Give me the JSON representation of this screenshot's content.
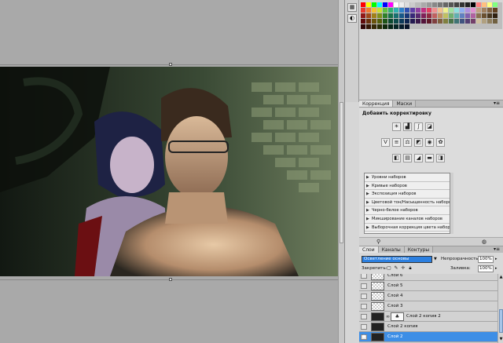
{
  "adjustments": {
    "tab_active": "Коррекция",
    "tab_inactive": "Маски",
    "title": "Добавить корректировку",
    "presets": [
      "Уровни наборов",
      "Кривые наборов",
      "Экспозиция наборов",
      "Цветовой тон/Насыщенность наборов",
      "Черно-белое наборов",
      "Микширование каналов наборов",
      "Выборочная коррекция цвета наборов"
    ]
  },
  "layers": {
    "tabs": [
      "Слои",
      "Каналы",
      "Контуры"
    ],
    "blend_mode": "Осветление основы",
    "opacity_label": "Непрозрачность:",
    "opacity_value": "100%",
    "lock_label": "Закрепить:",
    "fill_label": "Заливка:",
    "fill_value": "100%",
    "items": [
      {
        "name": "Слой 6"
      },
      {
        "name": "Слой 5"
      },
      {
        "name": "Слой 4"
      },
      {
        "name": "Слой 3"
      },
      {
        "name": "Слой 2 копия 2"
      },
      {
        "name": "Слой 2 копия"
      },
      {
        "name": "Слой 2"
      }
    ]
  },
  "colors": {
    "selection_blue": "#3d8ee6",
    "blend_field_blue": "#2b7fe0",
    "panel_gray": "#d6d6d6"
  }
}
